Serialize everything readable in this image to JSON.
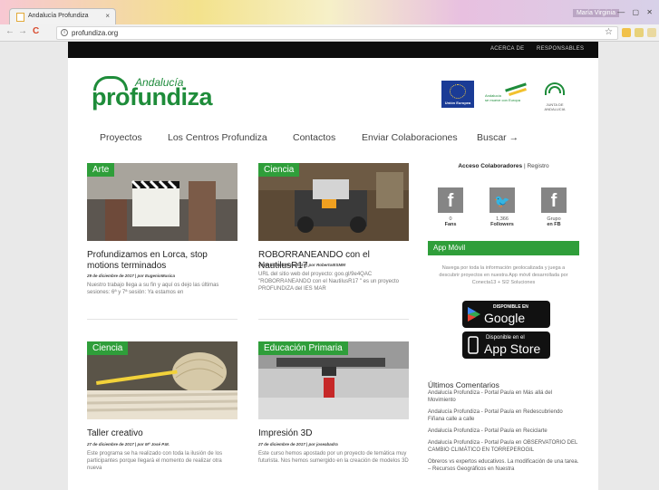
{
  "browser": {
    "tab_title": "Andalucía Profundiza",
    "tab_close": "×",
    "user": "María Virginia",
    "window_controls": "— ▢ ✕",
    "url": "profundiza.org",
    "back_icon": "←",
    "forward_icon": "→",
    "reload_icon": "C",
    "info_icon": "i",
    "star_icon": "☆"
  },
  "topbar": {
    "about": "ACERCA DE",
    "responsables": "RESPONSABLES"
  },
  "logo": {
    "small": "Andalucía",
    "big": "profundiza"
  },
  "sponsors": {
    "eu_label": "Unión Europea",
    "ag_text": "Andalucía\nse mueve con Europa",
    "ja_text": "JUNTA DE ANDALUCIA"
  },
  "nav": {
    "items": [
      "Proyectos",
      "Los Centros Profundiza",
      "Contactos",
      "Enviar Colaboraciones",
      "Buscar →"
    ]
  },
  "posts": [
    {
      "category": "Arte",
      "title": "Profundizamos en Lorca, stop motions terminados",
      "meta": "29 de diciembre de 2017 | por EugenioMusica",
      "excerpt": "Nuestro trabajo llega a su fin y aquí os dejo las últimas sesiones: 6ª y 7ª sesión: Ya estamos en"
    },
    {
      "category": "Ciencia",
      "title": "ROBORRANEANDO con el NautilusR17",
      "meta": "29 de diciembre de 2017 | por RobertoIESMM",
      "excerpt": "URL del sitio web del proyecto: goo.gl/9e4QAC \"ROBORRANEANDO  con el NautilusR17  \" es un proyecto PROFUNDIZA del IES MAR"
    },
    {
      "category": "Ciencia",
      "title": "Taller creativo",
      "meta": "27 de diciembre de 2017 | por Mª José P.M.",
      "excerpt": "Este programa se ha realizado con toda la ilusión de los participantes porque llegará el momento de realizar otra nueva"
    },
    {
      "category": "Educación Primaria",
      "title": "Impresión 3D",
      "meta": "27 de diciembre de 2017 | por joseabadra",
      "excerpt": "Este curso hemos apostado por un proyecto de temática muy futurista. Nos hemos sumergido en la creación de modelos 3D"
    }
  ],
  "sidebar": {
    "acceso": "Acceso Colaboradores",
    "divider": "|",
    "registro": "Registro",
    "social": [
      {
        "icon": "f",
        "count": "0",
        "label": "Fans"
      },
      {
        "icon": "🐦",
        "count": "1,366",
        "label": "Followers"
      },
      {
        "icon": "f",
        "count": "Grupo",
        "label": "en FB"
      }
    ],
    "app_title": "App Móvil",
    "app_text": "Navega por toda la información geolocalizada y juega a descubrir proyectos en nuestra App móvil desarrollada por Conecta13 + SI2 Soluciones",
    "gplay_small": "DISPONIBLE EN",
    "gplay_big": "Google play",
    "appstore_small": "Disponible en el",
    "appstore_big": "App Store",
    "comments_title": "Últimos Comentarios",
    "comments": [
      "Andalucía Profundiza - Portal Paula en Más allá del Movimiento",
      "Andalucía Profundiza - Portal Paula en Redescubriendo Fiñana calle a calle",
      "Andalucía Profundiza - Portal Paula en Reciclarte",
      "Andalucía Profundiza - Portal Paula en OBSERVATORIO DEL CAMBIO CLIMÁTICO EN TORREPEROGIL",
      "Obreros vs expertos educativos. La modificación de una tarea. – Recursos Geográficos en Nuestra"
    ]
  }
}
